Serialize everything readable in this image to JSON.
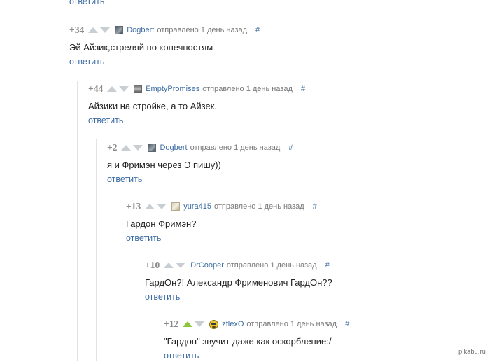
{
  "top_reply_label": "ответить",
  "watermark": "pikabu.ru",
  "comments": [
    {
      "rating": "+34",
      "upvoted": false,
      "avatar": "dogbert-avatar",
      "author": "Dogbert",
      "sent": "отправлено 1 день назад",
      "hash": "#",
      "text": "Эй Айзик,стреляй по конечностям",
      "reply": "ответить"
    },
    {
      "rating": "+44",
      "upvoted": false,
      "avatar": "emptypromises-avatar",
      "author": "EmptyPromises",
      "sent": "отправлено 1 день назад",
      "hash": "#",
      "text": "Айзики на стройке, а то Айзек.",
      "reply": "ответить"
    },
    {
      "rating": "+2",
      "upvoted": false,
      "avatar": "dogbert-avatar",
      "author": "Dogbert",
      "sent": "отправлено 1 день назад",
      "hash": "#",
      "text": "я и Фримэн через Э пишу))",
      "reply": "ответить"
    },
    {
      "rating": "+13",
      "upvoted": false,
      "avatar": "yura415-avatar",
      "author": "yura415",
      "sent": "отправлено 1 день назад",
      "hash": "#",
      "text": "Гардон Фримэн?",
      "reply": "ответить"
    },
    {
      "rating": "+10",
      "upvoted": false,
      "avatar": "",
      "author": "DrCooper",
      "sent": "отправлено 1 день назад",
      "hash": "#",
      "text": "ГардОн?! Александр Фрименович ГардОн??",
      "reply": "ответить"
    },
    {
      "rating": "+12",
      "upvoted": true,
      "avatar": "zflexo-avatar",
      "author": "zflexO",
      "sent": "отправлено 1 день назад",
      "hash": "#",
      "text": "\"Гардон\" звучит даже как оскорбление:/",
      "reply": "ответить"
    }
  ],
  "colors": {
    "link": "#3c6ca3",
    "rating": "#8a8a8a",
    "arrow_inactive": "#c9ced3",
    "arrow_upvoted": "#8cc63f",
    "thread_line": "#e3e3e3"
  }
}
